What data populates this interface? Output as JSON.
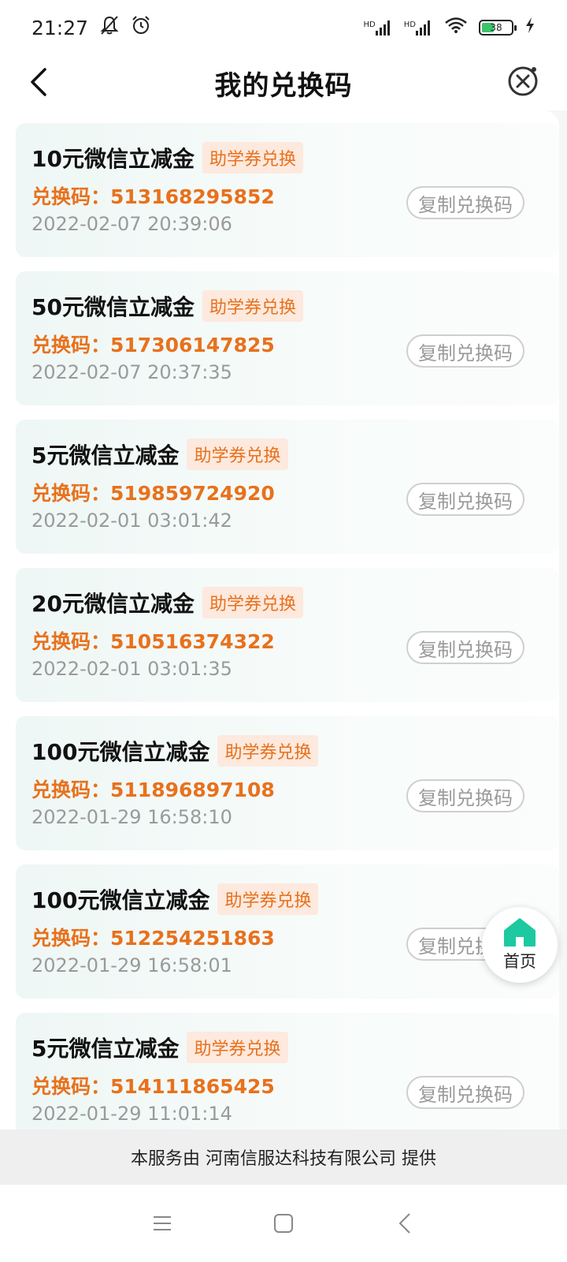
{
  "status_bar": {
    "time": "21:27",
    "network1": "HD",
    "network2": "HD",
    "battery": "38"
  },
  "header": {
    "title": "我的兑换码"
  },
  "coupons": [
    {
      "name": "10元微信立减金",
      "tag": "助学券兑换",
      "code_label": "兑换码：",
      "code": "513168295852",
      "time": "2022-02-07 20:39:06",
      "copy_label": "复制兑换码"
    },
    {
      "name": "50元微信立减金",
      "tag": "助学券兑换",
      "code_label": "兑换码：",
      "code": "517306147825",
      "time": "2022-02-07 20:37:35",
      "copy_label": "复制兑换码"
    },
    {
      "name": "5元微信立减金",
      "tag": "助学券兑换",
      "code_label": "兑换码：",
      "code": "519859724920",
      "time": "2022-02-01 03:01:42",
      "copy_label": "复制兑换码"
    },
    {
      "name": "20元微信立减金",
      "tag": "助学券兑换",
      "code_label": "兑换码：",
      "code": "510516374322",
      "time": "2022-02-01 03:01:35",
      "copy_label": "复制兑换码"
    },
    {
      "name": "100元微信立减金",
      "tag": "助学券兑换",
      "code_label": "兑换码：",
      "code": "511896897108",
      "time": "2022-01-29 16:58:10",
      "copy_label": "复制兑换码"
    },
    {
      "name": "100元微信立减金",
      "tag": "助学券兑换",
      "code_label": "兑换码：",
      "code": "512254251863",
      "time": "2022-01-29 16:58:01",
      "copy_label": "复制兑换码"
    },
    {
      "name": "5元微信立减金",
      "tag": "助学券兑换",
      "code_label": "兑换码：",
      "code": "514111865425",
      "time": "2022-01-29 11:01:14",
      "copy_label": "复制兑换码"
    }
  ],
  "home_fab": {
    "label": "首页",
    "icon": "home-icon"
  },
  "footer": {
    "text": "本服务由 河南信服达科技有限公司 提供"
  },
  "colors": {
    "accent": "#e8711c",
    "tag_bg": "#fde9de",
    "home": "#1cc9a0"
  }
}
